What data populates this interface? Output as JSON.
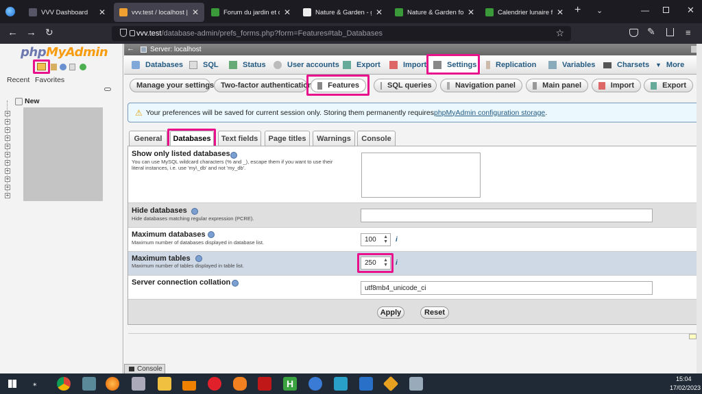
{
  "browser": {
    "tabs": [
      {
        "title": "VVV Dashboard",
        "active": false
      },
      {
        "title": "vvv.test / localhost | pl",
        "active": true
      },
      {
        "title": "Forum du jardin et du j",
        "active": false
      },
      {
        "title": "Nature & Garden - gar",
        "active": false
      },
      {
        "title": "Nature & Garden forur",
        "active": false
      },
      {
        "title": "Calendrier lunaire févri",
        "active": false
      }
    ],
    "new_tab": "+",
    "url_host": "vvv.test",
    "url_path": "/database-admin/prefs_forms.php?form=Features#tab_Databases"
  },
  "sidebar": {
    "logo_php": "php",
    "logo_myadmin": "MyAdmin",
    "recent": "Recent",
    "favorites": "Favorites",
    "new": "New"
  },
  "server_bar": "Server: localhost",
  "main_tabs": [
    "Databases",
    "SQL",
    "Status",
    "User accounts",
    "Export",
    "Import",
    "Settings",
    "Replication",
    "Variables",
    "Charsets",
    "More"
  ],
  "settings_tabs": [
    "Manage your settings",
    "Two-factor authentication",
    "Features",
    "SQL queries",
    "Navigation panel",
    "Main panel",
    "Import",
    "Export"
  ],
  "notice": {
    "text": "Your preferences will be saved for current session only. Storing them permanently requires ",
    "link": "phpMyAdmin configuration storage",
    "end": "."
  },
  "form_tabs": [
    "General",
    "Databases",
    "Text fields",
    "Page titles",
    "Warnings",
    "Console"
  ],
  "fields": {
    "show_only": {
      "label": "Show only listed databases",
      "desc1": "You can use MySQL wildcard characters (% and _), escape them if you want to use their",
      "desc2": "literal instances, i.e. use 'my\\_db' and not 'my_db'.",
      "value": ""
    },
    "hide": {
      "label": "Hide databases",
      "desc": "Hide databases matching regular expression (PCRE).",
      "value": ""
    },
    "max_db": {
      "label": "Maximum databases",
      "desc": "Maximum number of databases displayed in database list.",
      "value": "100"
    },
    "max_tables": {
      "label": "Maximum tables",
      "desc": "Maximum number of tables displayed in table list.",
      "value": "250"
    },
    "collation": {
      "label": "Server connection collation",
      "value": "utf8mb4_unicode_ci"
    }
  },
  "buttons": {
    "apply": "Apply",
    "reset": "Reset"
  },
  "console": "Console",
  "taskbar": {
    "time": "15:04",
    "date": "17/02/2023"
  },
  "colors": {
    "highlight": "#e8108b",
    "link": "#235a81",
    "logo_php": "#6c78af",
    "logo_myadmin": "#f89c0e"
  }
}
